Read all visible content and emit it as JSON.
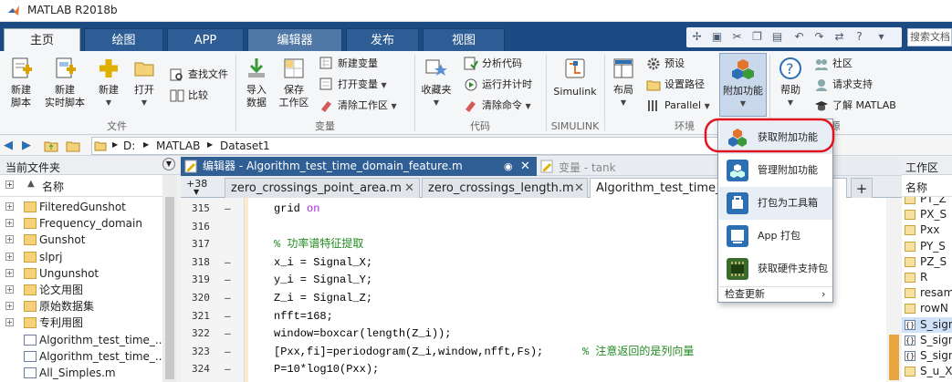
{
  "window": {
    "title": "MATLAB R2018b"
  },
  "ribbon_tabs": [
    {
      "label": "主页",
      "state": "active"
    },
    {
      "label": "绘图"
    },
    {
      "label": "APP"
    },
    {
      "label": "编辑器"
    },
    {
      "label": "发布"
    },
    {
      "label": "视图"
    }
  ],
  "search_docs": {
    "placeholder": "搜索文档"
  },
  "ribbon": {
    "file": {
      "new_script": "新建\n脚本",
      "new_live_script": "新建\n实时脚本",
      "new": "新建",
      "open": "打开",
      "find_files": "查找文件",
      "compare": "比较",
      "section": "文件"
    },
    "variable": {
      "import_data": "导入\n数据",
      "save_workspace": "保存\n工作区",
      "new_variable": "新建变量",
      "open_variable": "打开变量",
      "clear_workspace": "清除工作区",
      "section": "变量"
    },
    "code": {
      "favorites": "收藏夹",
      "analyze_code": "分析代码",
      "run_and_time": "运行并计时",
      "clear_commands": "清除命令",
      "section": "代码"
    },
    "simulink": {
      "label": "Simulink",
      "section": "SIMULINK"
    },
    "environment": {
      "layout": "布局",
      "preferences": "预设",
      "set_path": "设置路径",
      "parallel": "Parallel",
      "addons": "附加功能",
      "section": "环境"
    },
    "resources": {
      "help": "帮助",
      "community": "社区",
      "request_support": "请求支持",
      "learn_matlab": "了解 MATLAB",
      "section_partial": "源"
    }
  },
  "address_bar": {
    "path": [
      "D:",
      "MATLAB",
      "Dataset1"
    ]
  },
  "current_folder": {
    "title": "当前文件夹",
    "column_name": "名称",
    "items": [
      {
        "name": "FilteredGunshot",
        "type": "folder"
      },
      {
        "name": "Frequency_domain",
        "type": "folder"
      },
      {
        "name": "Gunshot",
        "type": "folder"
      },
      {
        "name": "slprj",
        "type": "folder"
      },
      {
        "name": "Ungunshot",
        "type": "folder"
      },
      {
        "name": "论文用图",
        "type": "folder"
      },
      {
        "name": "原始数据集",
        "type": "folder"
      },
      {
        "name": "专利用图",
        "type": "folder"
      },
      {
        "name": "Algorithm_test_time_...",
        "type": "mfile"
      },
      {
        "name": "Algorithm_test_time_...",
        "type": "mfile"
      },
      {
        "name": "All_Simples.m",
        "type": "mfile"
      }
    ]
  },
  "editor": {
    "title": "编辑器 - Algorithm_test_time_domain_feature.m",
    "variable_panel_title": "变量 - tank",
    "tab_count": "+38",
    "tabs": [
      {
        "label": "zero_crossings_point_area.m"
      },
      {
        "label": "zero_crossings_length.m"
      },
      {
        "label": "Algorithm_test_time_",
        "active": true
      }
    ],
    "lines": [
      {
        "n": "315",
        "dash": "—",
        "code": "grid on",
        "kw": "on"
      },
      {
        "n": "316",
        "dash": "",
        "code": ""
      },
      {
        "n": "317",
        "dash": "",
        "code": "% 功率谱特征提取",
        "type": "comment"
      },
      {
        "n": "318",
        "dash": "—",
        "code": "x_i = Signal_X;"
      },
      {
        "n": "319",
        "dash": "—",
        "code": "y_i = Signal_Y;"
      },
      {
        "n": "320",
        "dash": "—",
        "code": "Z_i = Signal_Z;"
      },
      {
        "n": "321",
        "dash": "—",
        "code": "nfft=168;"
      },
      {
        "n": "322",
        "dash": "—",
        "code": "window=boxcar(length(Z_i));"
      },
      {
        "n": "323",
        "dash": "—",
        "code": "[Pxx,fi]=periodogram(Z_i,window,nfft,Fs);",
        "comment": "% 注意返回的是列向量"
      },
      {
        "n": "324",
        "dash": "—",
        "code": "P=10*log10(Pxx);"
      }
    ]
  },
  "workspace": {
    "title": "工作区",
    "column_name": "名称",
    "items": [
      "PT_Z",
      "PX_S",
      "Pxx",
      "PY_S",
      "PZ_S",
      "R",
      "resam",
      "rowN",
      "S_sign",
      "S_sign",
      "S_sign",
      "S_u_X"
    ]
  },
  "addons_menu": {
    "items": [
      {
        "label": "获取附加功能",
        "highlighted": true
      },
      {
        "label": "管理附加功能"
      },
      {
        "label": "打包为工具箱"
      },
      {
        "label": "App 打包"
      },
      {
        "label": "获取硬件支持包"
      }
    ],
    "check_updates": "检查更新"
  },
  "colors": {
    "accent": "#1c4a82",
    "annotation_red": "#e0141e",
    "editor_title": "#2f5f95"
  }
}
